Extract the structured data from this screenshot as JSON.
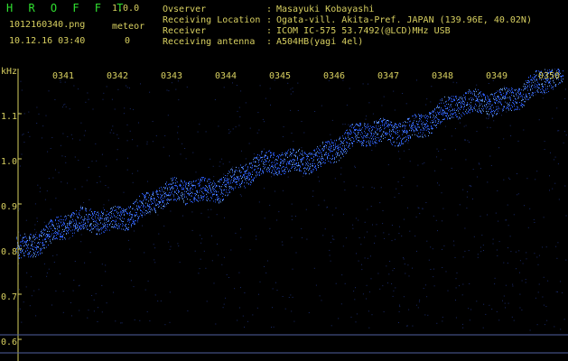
{
  "header": {
    "app_name": "H R O F F T",
    "version": "1.0.0",
    "filename": "1012160340.png",
    "meteor_label": "meteor",
    "datetime": "10.12.16 03:40",
    "meteor_count": "0"
  },
  "info": [
    {
      "key": "Ovserver",
      "value": "Masayuki Kobayashi"
    },
    {
      "key": "Receiving Location",
      "value": "Ogata-vill. Akita-Pref. JAPAN (139.96E, 40.02N)"
    },
    {
      "key": "Receiver",
      "value": "ICOM IC-575 53.7492(@LCD)MHz USB"
    },
    {
      "key": "Receiving antenna",
      "value": "A504HB(yagi 4el)"
    }
  ],
  "spectrogram": {
    "y_unit": "kHz",
    "y_ticks": [
      "1.1",
      "1.0",
      "0.9",
      "0.8",
      "0.7",
      "0.6"
    ],
    "time_ticks": [
      "0341",
      "0342",
      "0343",
      "0344",
      "0345",
      "0346",
      "0347",
      "0348",
      "0349",
      "0350"
    ],
    "colors": {
      "signal": "#2b5dff",
      "signal_bright": "#6fa8ff",
      "ticks": "#d8d060",
      "grid": "#1a2a6a"
    }
  }
}
